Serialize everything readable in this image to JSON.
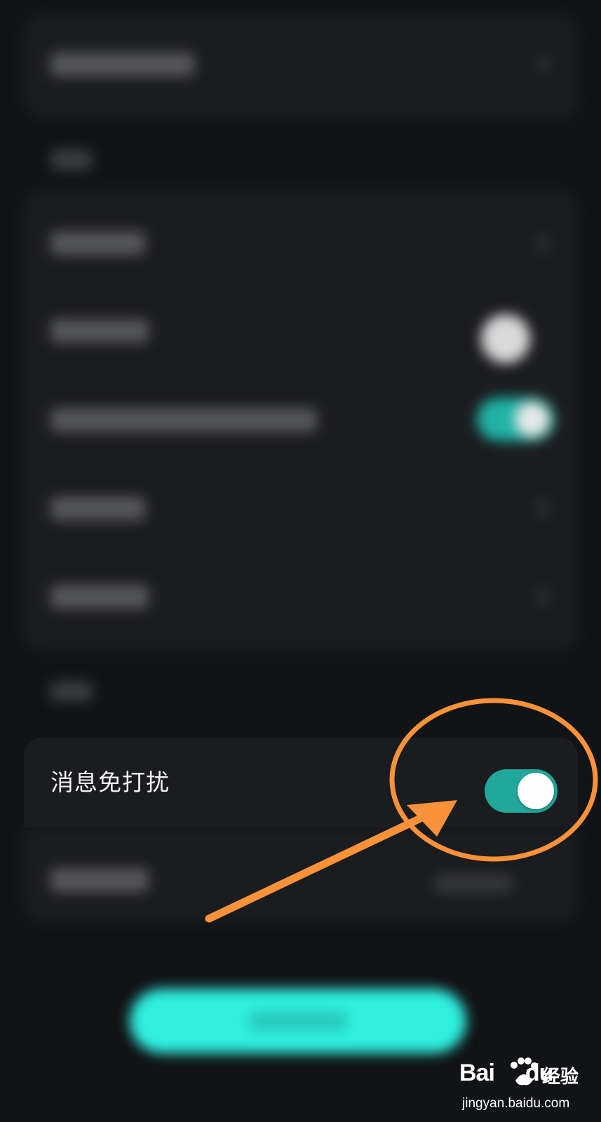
{
  "settings": {
    "dnd_label": "消息免打扰",
    "dnd_enabled": true
  },
  "colors": {
    "background": "#111316",
    "card": "#1b1c20",
    "toggle_on": "#21a89a",
    "primary_button": "#2ff0e0",
    "annotation": "#f7923a"
  },
  "watermark": {
    "logo_text": "Bai",
    "logo_text2": "du",
    "logo_cn": "经验",
    "url": "jingyan.baidu.com"
  }
}
